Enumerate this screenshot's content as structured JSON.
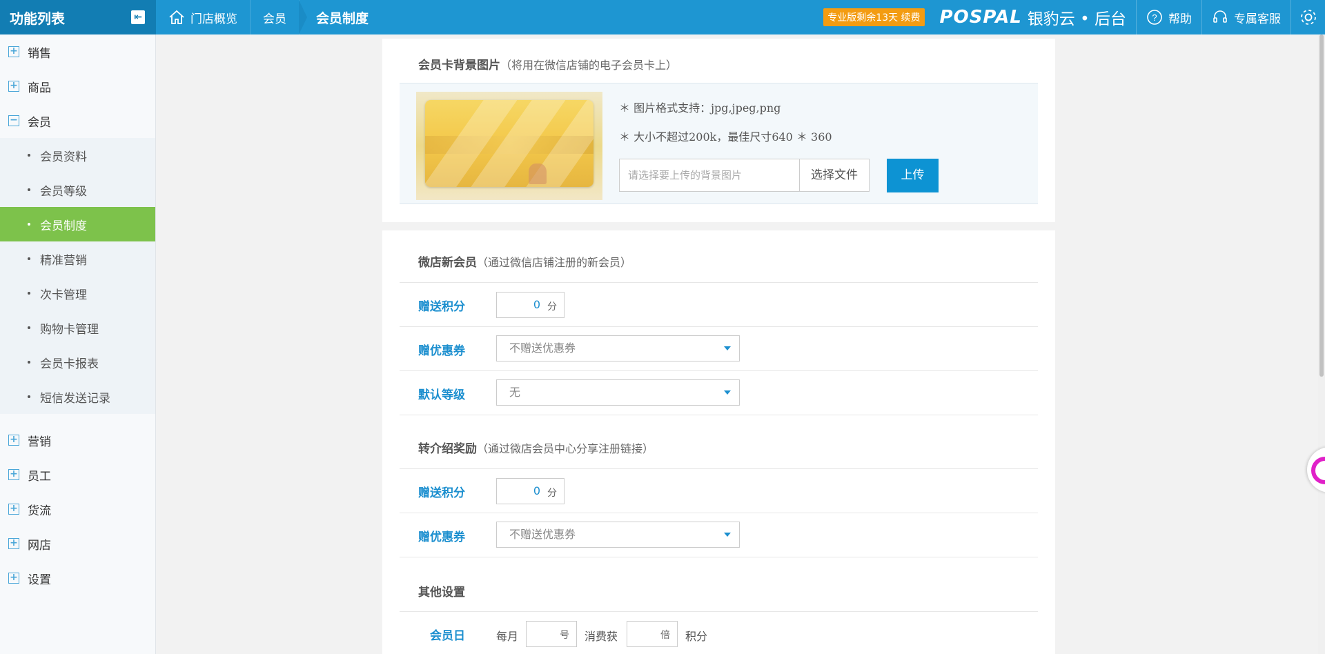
{
  "header": {
    "fn_title": "功能列表",
    "breadcrumbs": [
      "门店概览",
      "会员",
      "会员制度"
    ],
    "renew_badge": "专业版剩余13天  续费",
    "brand_en": "POSPAL",
    "brand_cn": "银豹云 • 后台",
    "help": "帮助",
    "service": "专属客服"
  },
  "sidebar": {
    "groups_top": [
      {
        "label": "销售",
        "marker": "+"
      },
      {
        "label": "商品",
        "marker": "+"
      },
      {
        "label": "会员",
        "marker": "−"
      }
    ],
    "member_items": [
      "会员资料",
      "会员等级",
      "会员制度",
      "精准营销",
      "次卡管理",
      "购物卡管理",
      "会员卡报表",
      "短信发送记录"
    ],
    "active_item": "会员制度",
    "groups_bottom": [
      {
        "label": "营销",
        "marker": "+"
      },
      {
        "label": "员工",
        "marker": "+"
      },
      {
        "label": "货流",
        "marker": "+"
      },
      {
        "label": "网店",
        "marker": "+"
      },
      {
        "label": "设置",
        "marker": "+"
      }
    ]
  },
  "bg_section": {
    "title": "会员卡背景图片",
    "note": "（将用在微信店铺的电子会员卡上）",
    "hint1": "＊ 图片格式支持：jpg,jpeg,png",
    "hint2": "＊ 大小不超过200k，最佳尺寸640 ＊ 360",
    "file_placeholder": "请选择要上传的背景图片",
    "choose_file": "选择文件",
    "upload": "上传"
  },
  "new_member": {
    "title": "微店新会员",
    "note": "（通过微信店铺注册的新会员）",
    "points_label": "赠送积分",
    "points_value": "0",
    "points_unit": "分",
    "coupon_label": "赠优惠券",
    "coupon_value": "不赠送优惠券",
    "level_label": "默认等级",
    "level_value": "无"
  },
  "referral": {
    "title": "转介绍奖励",
    "note": "（通过微店会员中心分享注册链接）",
    "points_label": "赠送积分",
    "points_value": "0",
    "points_unit": "分",
    "coupon_label": "赠优惠券",
    "coupon_value": "不赠送优惠券"
  },
  "other": {
    "title": "其他设置",
    "member_day_label": "会员日",
    "monthly": "每月",
    "day_unit": "号",
    "consume_get": "消费获",
    "times_unit": "倍",
    "points_word": "积分"
  },
  "colors": {
    "header": "#1e96d2",
    "active_item": "#7dc24b",
    "accent": "#1c8fcf",
    "renew": "#f39c12"
  }
}
